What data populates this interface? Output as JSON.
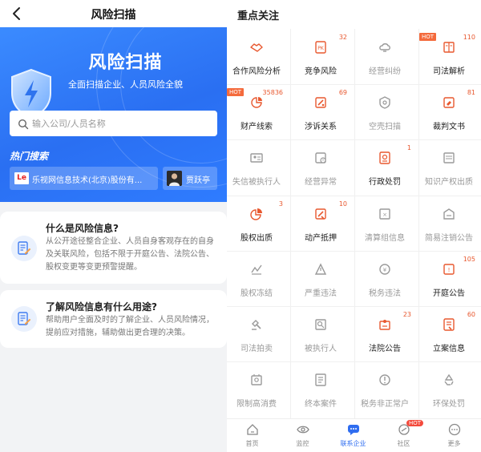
{
  "left": {
    "title": "风险扫描",
    "hero": {
      "title": "风险扫描",
      "subtitle": "全面扫描企业、人员风险全貌",
      "search_placeholder": "输入公司/人员名称",
      "hot_search_label": "热门搜索",
      "hot_items": [
        {
          "logo": "Le",
          "label": "乐视网信息技术(北京)股份有..."
        },
        {
          "label": "贾跃亭"
        }
      ]
    },
    "cards": [
      {
        "title": "什么是风险信息?",
        "body": "从公开途径整合企业、人员自身客观存在的自身及关联风险，包括不限于开庭公告、法院公告、股权变更等变更预警提醒。"
      },
      {
        "title": "了解风险信息有什么用途?",
        "body": "帮助用户全面及时的了解企业、人员风险情况，提前应对措施，辅助做出更合理的决策。"
      }
    ]
  },
  "right": {
    "title": "重点关注",
    "accent": "#e8582f",
    "items": [
      {
        "label": "合作风险分析",
        "icon": "handshake-icon",
        "active": true
      },
      {
        "label": "竞争风险",
        "icon": "pk-icon",
        "count": "32",
        "active": true
      },
      {
        "label": "经营纠纷",
        "icon": "cloud-dispute-icon",
        "active": false
      },
      {
        "label": "司法解析",
        "icon": "book-icon",
        "count": "110",
        "hot": "HOT",
        "active": true
      },
      {
        "label": "财产线索",
        "icon": "property-icon",
        "count": "35836",
        "hot": "HOT",
        "active": true
      },
      {
        "label": "涉诉关系",
        "icon": "lawsuit-icon",
        "count": "69",
        "active": true
      },
      {
        "label": "空壳扫描",
        "icon": "shell-icon",
        "active": false
      },
      {
        "label": "裁判文书",
        "icon": "verdict-icon",
        "count": "81",
        "active": true
      },
      {
        "label": "失信被执行人",
        "icon": "dishonest-icon",
        "active": false
      },
      {
        "label": "经营异常",
        "icon": "abnormal-icon",
        "active": false
      },
      {
        "label": "行政处罚",
        "icon": "penalty-icon",
        "count": "1",
        "active": true
      },
      {
        "label": "知识产权出质",
        "icon": "ip-pledge-icon",
        "active": false
      },
      {
        "label": "股权出质",
        "icon": "pie-chart-icon",
        "count": "3",
        "active": true
      },
      {
        "label": "动产抵押",
        "icon": "mortgage-icon",
        "count": "10",
        "active": true
      },
      {
        "label": "清算组信息",
        "icon": "liquidation-icon",
        "active": false
      },
      {
        "label": "简易注销公告",
        "icon": "cancellation-icon",
        "active": false
      },
      {
        "label": "股权冻结",
        "icon": "equity-freeze-icon",
        "active": false
      },
      {
        "label": "严重违法",
        "icon": "serious-violation-icon",
        "active": false
      },
      {
        "label": "税务违法",
        "icon": "tax-violation-icon",
        "active": false
      },
      {
        "label": "开庭公告",
        "icon": "court-session-icon",
        "count": "105",
        "active": true
      },
      {
        "label": "司法拍卖",
        "icon": "gavel-icon",
        "active": false
      },
      {
        "label": "被执行人",
        "icon": "executed-icon",
        "active": false
      },
      {
        "label": "法院公告",
        "icon": "court-notice-icon",
        "count": "23",
        "active": true
      },
      {
        "label": "立案信息",
        "icon": "filing-icon",
        "count": "60",
        "active": true
      },
      {
        "label": "限制高消费",
        "icon": "restriction-icon",
        "active": false
      },
      {
        "label": "终本案件",
        "icon": "final-case-icon",
        "active": false
      },
      {
        "label": "税务非正常户",
        "icon": "tax-abnormal-icon",
        "active": false
      },
      {
        "label": "环保处罚",
        "icon": "recycle-icon",
        "active": false
      }
    ],
    "tabs": [
      {
        "label": "首页",
        "icon": "home-icon"
      },
      {
        "label": "监控",
        "icon": "eye-icon"
      },
      {
        "label": "联系企业",
        "icon": "chat-icon",
        "active": true
      },
      {
        "label": "社区",
        "icon": "community-icon",
        "hot": "HOT"
      },
      {
        "label": "更多",
        "icon": "more-icon"
      }
    ]
  }
}
